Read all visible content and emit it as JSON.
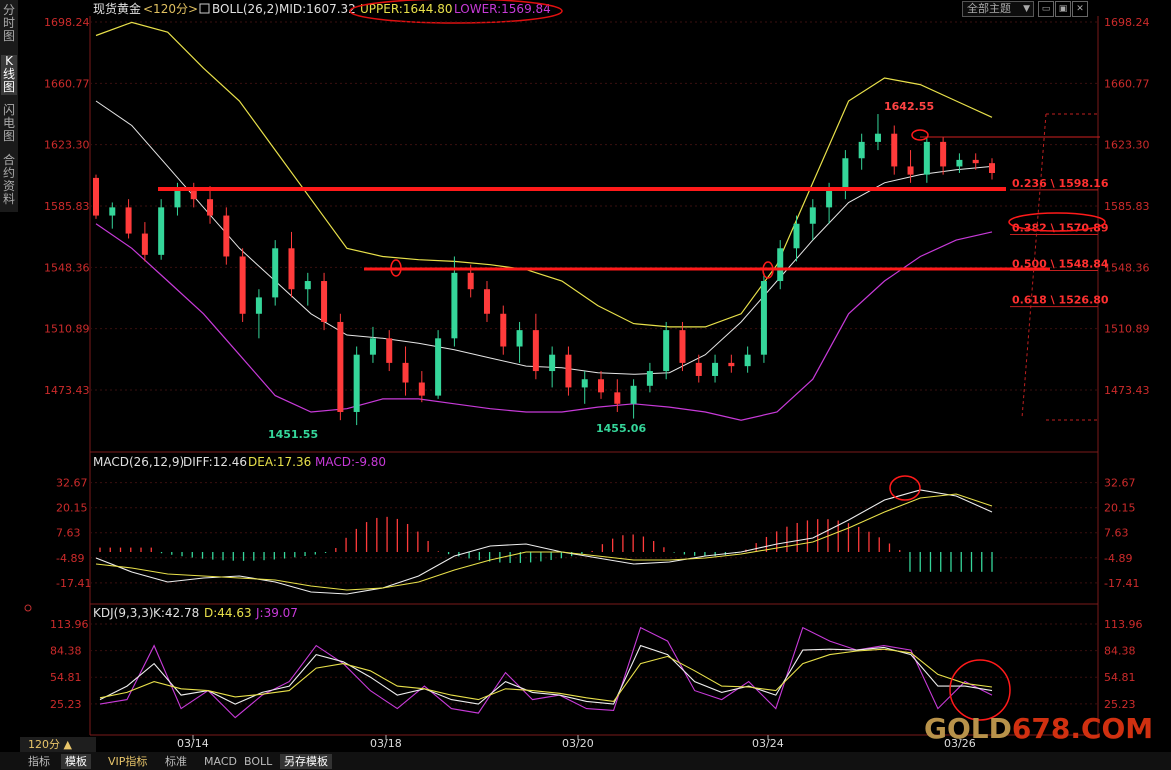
{
  "nav": [
    "分时图",
    "K线图",
    "闪电图",
    "合约资料"
  ],
  "header": {
    "instrument": "现货黄金",
    "period": "<120分>",
    "boll_label": "BOLL(26,2)",
    "mid": "MID:1607.32",
    "upper": "UPPER:1644.80",
    "lower": "LOWER:1569.84",
    "theme": "全部主题",
    "theme_arrow": "▼"
  },
  "colors": {
    "up": "#35d69a",
    "down": "#ff3b3b",
    "mid": "#e6e6e6",
    "upper": "#e8e04a",
    "lower": "#c73ad8",
    "grid": "#3a1414",
    "axis": "#cc2b2b"
  },
  "main_axis": {
    "ticks": [
      "1698.24",
      "1660.77",
      "1623.30",
      "1585.83",
      "1548.36",
      "1510.89",
      "1473.43"
    ]
  },
  "price_annotations": {
    "high": "1642.55",
    "low1": "1451.55",
    "low2": "1455.06"
  },
  "fibonacci": [
    {
      "label": "0.236 \\ 1598.16",
      "price": 1598.16
    },
    {
      "label": "0.382 \\ 1570.89",
      "price": 1570.89
    },
    {
      "label": "0.500 \\ 1548.84",
      "price": 1548.84
    },
    {
      "label": "0.618 \\ 1526.80",
      "price": 1526.8
    }
  ],
  "macd": {
    "label": "MACD(26,12,9)",
    "diff": "DIFF:12.46",
    "dea": "DEA:17.36",
    "macd": "MACD:-9.80",
    "ticks": [
      "32.67",
      "20.15",
      "7.63",
      "-4.89",
      "-17.41"
    ]
  },
  "kdj": {
    "label": "KDJ(9,3,3)",
    "k": "K:42.78",
    "d": "D:44.63",
    "j": "J:39.07",
    "ticks": [
      "113.96",
      "84.38",
      "54.81",
      "25.23"
    ]
  },
  "dates": [
    "03/14",
    "03/18",
    "03/20",
    "03/24",
    "03/26"
  ],
  "period_button": "120分 ▲",
  "tabs": [
    "指标",
    "模板",
    "VIP指标",
    "标准",
    "MACD",
    "BOLL",
    "另存模板"
  ],
  "watermark_a": "GOLD",
  "watermark_b": "678.COM",
  "chart_data": {
    "type": "candlestick",
    "instrument": "现货黄金",
    "interval": "120分",
    "candles_approx": [
      {
        "o": 1603,
        "h": 1605,
        "l": 1578,
        "c": 1580
      },
      {
        "o": 1580,
        "h": 1588,
        "l": 1572,
        "c": 1585
      },
      {
        "o": 1585,
        "h": 1590,
        "l": 1566,
        "c": 1569
      },
      {
        "o": 1569,
        "h": 1576,
        "l": 1552,
        "c": 1556
      },
      {
        "o": 1556,
        "h": 1590,
        "l": 1553,
        "c": 1585
      },
      {
        "o": 1585,
        "h": 1600,
        "l": 1580,
        "c": 1596
      },
      {
        "o": 1596,
        "h": 1600,
        "l": 1585,
        "c": 1590
      },
      {
        "o": 1590,
        "h": 1598,
        "l": 1575,
        "c": 1580
      },
      {
        "o": 1580,
        "h": 1585,
        "l": 1550,
        "c": 1555
      },
      {
        "o": 1555,
        "h": 1560,
        "l": 1515,
        "c": 1520
      },
      {
        "o": 1520,
        "h": 1535,
        "l": 1505,
        "c": 1530
      },
      {
        "o": 1530,
        "h": 1565,
        "l": 1525,
        "c": 1560
      },
      {
        "o": 1560,
        "h": 1570,
        "l": 1530,
        "c": 1535
      },
      {
        "o": 1535,
        "h": 1545,
        "l": 1525,
        "c": 1540
      },
      {
        "o": 1540,
        "h": 1545,
        "l": 1510,
        "c": 1515
      },
      {
        "o": 1515,
        "h": 1520,
        "l": 1455,
        "c": 1460
      },
      {
        "o": 1460,
        "h": 1500,
        "l": 1452,
        "c": 1495
      },
      {
        "o": 1495,
        "h": 1512,
        "l": 1490,
        "c": 1505
      },
      {
        "o": 1505,
        "h": 1510,
        "l": 1485,
        "c": 1490
      },
      {
        "o": 1490,
        "h": 1500,
        "l": 1470,
        "c": 1478
      },
      {
        "o": 1478,
        "h": 1485,
        "l": 1466,
        "c": 1470
      },
      {
        "o": 1470,
        "h": 1510,
        "l": 1468,
        "c": 1505
      },
      {
        "o": 1505,
        "h": 1555,
        "l": 1500,
        "c": 1545
      },
      {
        "o": 1545,
        "h": 1550,
        "l": 1530,
        "c": 1535
      },
      {
        "o": 1535,
        "h": 1540,
        "l": 1515,
        "c": 1520
      },
      {
        "o": 1520,
        "h": 1525,
        "l": 1495,
        "c": 1500
      },
      {
        "o": 1500,
        "h": 1515,
        "l": 1490,
        "c": 1510
      },
      {
        "o": 1510,
        "h": 1520,
        "l": 1480,
        "c": 1485
      },
      {
        "o": 1485,
        "h": 1500,
        "l": 1475,
        "c": 1495
      },
      {
        "o": 1495,
        "h": 1500,
        "l": 1470,
        "c": 1475
      },
      {
        "o": 1475,
        "h": 1485,
        "l": 1465,
        "c": 1480
      },
      {
        "o": 1480,
        "h": 1485,
        "l": 1468,
        "c": 1472
      },
      {
        "o": 1472,
        "h": 1480,
        "l": 1460,
        "c": 1465
      },
      {
        "o": 1465,
        "h": 1480,
        "l": 1456,
        "c": 1476
      },
      {
        "o": 1476,
        "h": 1490,
        "l": 1472,
        "c": 1485
      },
      {
        "o": 1485,
        "h": 1515,
        "l": 1480,
        "c": 1510
      },
      {
        "o": 1510,
        "h": 1515,
        "l": 1485,
        "c": 1490
      },
      {
        "o": 1490,
        "h": 1495,
        "l": 1478,
        "c": 1482
      },
      {
        "o": 1482,
        "h": 1495,
        "l": 1478,
        "c": 1490
      },
      {
        "o": 1490,
        "h": 1495,
        "l": 1484,
        "c": 1488
      },
      {
        "o": 1488,
        "h": 1500,
        "l": 1484,
        "c": 1495
      },
      {
        "o": 1495,
        "h": 1545,
        "l": 1490,
        "c": 1540
      },
      {
        "o": 1540,
        "h": 1565,
        "l": 1535,
        "c": 1560
      },
      {
        "o": 1560,
        "h": 1580,
        "l": 1552,
        "c": 1575
      },
      {
        "o": 1575,
        "h": 1590,
        "l": 1565,
        "c": 1585
      },
      {
        "o": 1585,
        "h": 1600,
        "l": 1575,
        "c": 1595
      },
      {
        "o": 1595,
        "h": 1620,
        "l": 1590,
        "c": 1615
      },
      {
        "o": 1615,
        "h": 1630,
        "l": 1608,
        "c": 1625
      },
      {
        "o": 1625,
        "h": 1642,
        "l": 1620,
        "c": 1630
      },
      {
        "o": 1630,
        "h": 1635,
        "l": 1605,
        "c": 1610
      },
      {
        "o": 1610,
        "h": 1620,
        "l": 1600,
        "c": 1605
      },
      {
        "o": 1605,
        "h": 1628,
        "l": 1600,
        "c": 1625
      },
      {
        "o": 1625,
        "h": 1628,
        "l": 1605,
        "c": 1610
      },
      {
        "o": 1610,
        "h": 1618,
        "l": 1606,
        "c": 1614
      },
      {
        "o": 1614,
        "h": 1618,
        "l": 1608,
        "c": 1612
      },
      {
        "o": 1612,
        "h": 1615,
        "l": 1602,
        "c": 1606
      }
    ]
  }
}
